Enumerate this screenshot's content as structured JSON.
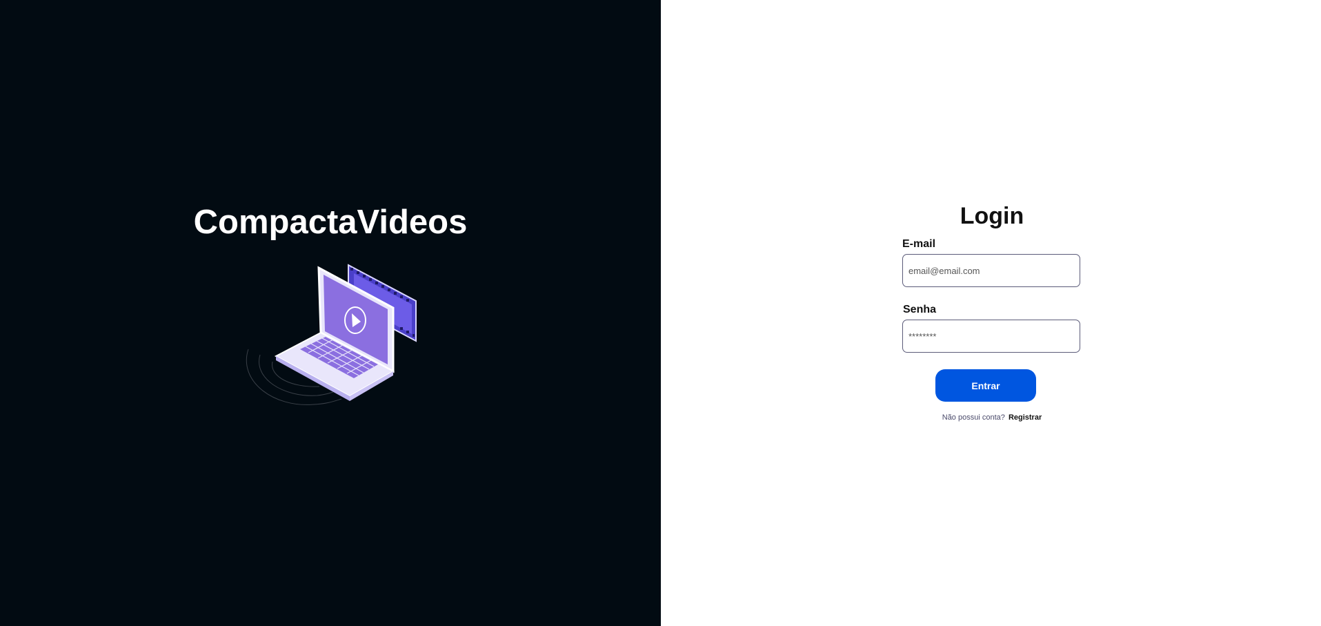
{
  "brand": {
    "title": "CompactaVideos"
  },
  "login": {
    "title": "Login",
    "email_label": "E-mail",
    "email_placeholder": "email@email.com",
    "password_label": "Senha",
    "password_placeholder": "********",
    "submit_label": "Entrar",
    "register_question": "Não possui conta?",
    "register_link": "Registrar"
  },
  "colors": {
    "left_background": "#020b12",
    "accent_button": "#0056e0",
    "illustration_purple": "#8b6fe0"
  },
  "icons": {
    "illustration": "laptop-video-illustration"
  }
}
